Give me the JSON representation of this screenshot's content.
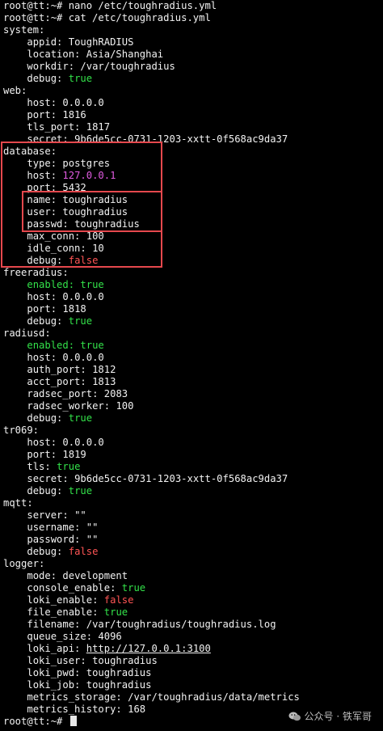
{
  "prompt_lines": [
    "root@tt:~# nano /etc/toughradius.yml",
    "root@tt:~# cat /etc/toughradius.yml"
  ],
  "lines": [
    {
      "indent": 0,
      "key": "system:",
      "value": "",
      "color": ""
    },
    {
      "indent": 4,
      "key": "appid:",
      "value": "ToughRADIUS",
      "color": ""
    },
    {
      "indent": 4,
      "key": "location:",
      "value": "Asia/Shanghai",
      "color": ""
    },
    {
      "indent": 4,
      "key": "workdir:",
      "value": "/var/toughradius",
      "color": ""
    },
    {
      "indent": 4,
      "key": "debug:",
      "value": "true",
      "color": "green"
    },
    {
      "indent": 0,
      "key": "web:",
      "value": "",
      "color": ""
    },
    {
      "indent": 4,
      "key": "host:",
      "value": "0.0.0.0",
      "color": ""
    },
    {
      "indent": 4,
      "key": "port:",
      "value": "1816",
      "color": ""
    },
    {
      "indent": 4,
      "key": "tls_port:",
      "value": "1817",
      "color": ""
    },
    {
      "indent": 4,
      "key": "secret:",
      "value": "9b6de5cc-0731-1203-xxtt-0f568ac9da37",
      "color": ""
    },
    {
      "indent": 0,
      "key": "database:",
      "value": "",
      "color": ""
    },
    {
      "indent": 4,
      "key": "type:",
      "value": "postgres",
      "color": ""
    },
    {
      "indent": 4,
      "key": "host:",
      "value": "127.0.0.1",
      "color": "magenta"
    },
    {
      "indent": 4,
      "key": "port:",
      "value": "5432",
      "color": ""
    },
    {
      "indent": 4,
      "key": "name:",
      "value": "toughradius",
      "color": ""
    },
    {
      "indent": 4,
      "key": "user:",
      "value": "toughradius",
      "color": ""
    },
    {
      "indent": 4,
      "key": "passwd:",
      "value": "toughradius",
      "color": ""
    },
    {
      "indent": 4,
      "key": "max_conn:",
      "value": "100",
      "color": ""
    },
    {
      "indent": 4,
      "key": "idle_conn:",
      "value": "10",
      "color": ""
    },
    {
      "indent": 4,
      "key": "debug:",
      "value": "false",
      "color": "red"
    },
    {
      "indent": 0,
      "key": "freeradius:",
      "value": "",
      "color": ""
    },
    {
      "indent": 4,
      "key": "enabled:",
      "value": "true",
      "color": "green",
      "keycolor": "green"
    },
    {
      "indent": 4,
      "key": "host:",
      "value": "0.0.0.0",
      "color": ""
    },
    {
      "indent": 4,
      "key": "port:",
      "value": "1818",
      "color": ""
    },
    {
      "indent": 4,
      "key": "debug:",
      "value": "true",
      "color": "green"
    },
    {
      "indent": 0,
      "key": "radiusd:",
      "value": "",
      "color": ""
    },
    {
      "indent": 4,
      "key": "enabled:",
      "value": "true",
      "color": "green",
      "keycolor": "green"
    },
    {
      "indent": 4,
      "key": "host:",
      "value": "0.0.0.0",
      "color": ""
    },
    {
      "indent": 4,
      "key": "auth_port:",
      "value": "1812",
      "color": ""
    },
    {
      "indent": 4,
      "key": "acct_port:",
      "value": "1813",
      "color": ""
    },
    {
      "indent": 4,
      "key": "radsec_port:",
      "value": "2083",
      "color": ""
    },
    {
      "indent": 4,
      "key": "radsec_worker:",
      "value": "100",
      "color": ""
    },
    {
      "indent": 4,
      "key": "debug:",
      "value": "true",
      "color": "green"
    },
    {
      "indent": 0,
      "key": "tr069:",
      "value": "",
      "color": ""
    },
    {
      "indent": 4,
      "key": "host:",
      "value": "0.0.0.0",
      "color": ""
    },
    {
      "indent": 4,
      "key": "port:",
      "value": "1819",
      "color": ""
    },
    {
      "indent": 4,
      "key": "tls:",
      "value": "true",
      "color": "green"
    },
    {
      "indent": 4,
      "key": "secret:",
      "value": "9b6de5cc-0731-1203-xxtt-0f568ac9da37",
      "color": ""
    },
    {
      "indent": 4,
      "key": "debug:",
      "value": "true",
      "color": "green"
    },
    {
      "indent": 0,
      "key": "mqtt:",
      "value": "",
      "color": ""
    },
    {
      "indent": 4,
      "key": "server:",
      "value": "\"\"",
      "color": ""
    },
    {
      "indent": 4,
      "key": "username:",
      "value": "\"\"",
      "color": ""
    },
    {
      "indent": 4,
      "key": "password:",
      "value": "\"\"",
      "color": ""
    },
    {
      "indent": 4,
      "key": "debug:",
      "value": "false",
      "color": "red"
    },
    {
      "indent": 0,
      "key": "logger:",
      "value": "",
      "color": ""
    },
    {
      "indent": 4,
      "key": "mode:",
      "value": "development",
      "color": ""
    },
    {
      "indent": 4,
      "key": "console_enable:",
      "value": "true",
      "color": "green"
    },
    {
      "indent": 4,
      "key": "loki_enable:",
      "value": "false",
      "color": "red"
    },
    {
      "indent": 4,
      "key": "file_enable:",
      "value": "true",
      "color": "green"
    },
    {
      "indent": 4,
      "key": "filename:",
      "value": "/var/toughradius/toughradius.log",
      "color": ""
    },
    {
      "indent": 4,
      "key": "queue_size:",
      "value": "4096",
      "color": ""
    },
    {
      "indent": 4,
      "key": "loki_api:",
      "value": "http://127.0.0.1:3100",
      "color": "url"
    },
    {
      "indent": 4,
      "key": "loki_user:",
      "value": "toughradius",
      "color": ""
    },
    {
      "indent": 4,
      "key": "loki_pwd:",
      "value": "toughradius",
      "color": ""
    },
    {
      "indent": 4,
      "key": "loki_job:",
      "value": "toughradius",
      "color": ""
    },
    {
      "indent": 4,
      "key": "metrics_storage:",
      "value": "/var/toughradius/data/metrics",
      "color": ""
    },
    {
      "indent": 4,
      "key": "metrics_history:",
      "value": "168",
      "color": ""
    }
  ],
  "final_prompt": "root@tt:~# ",
  "watermark": "公众号 · 铁军哥",
  "colors": {
    "background": "#000000",
    "text": "#f2f2f2",
    "true_value": "#33e24a",
    "false_value": "#ff5555",
    "ip_value": "#e05be0",
    "highlight_box": "#e5484d"
  }
}
